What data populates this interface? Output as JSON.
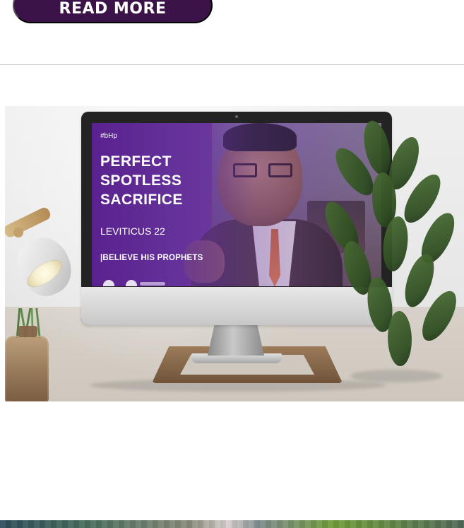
{
  "top_action": {
    "read_more_label": "READ MORE"
  },
  "feature_card": {
    "screen": {
      "tag": "#bHp",
      "title": "PERFECT\nSPOTLESS\nSACRIFICE",
      "passage": "LEVITICUS 22",
      "series": "|BELIEVE HIS PROPHETS"
    }
  }
}
